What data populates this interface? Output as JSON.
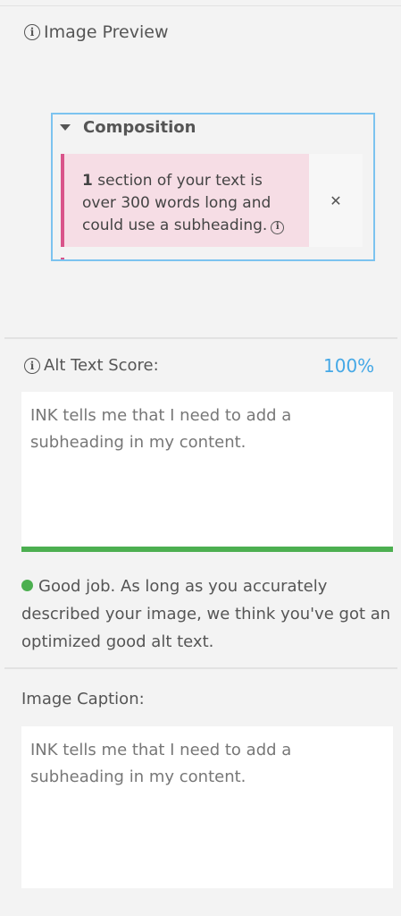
{
  "preview": {
    "label": "Image Preview",
    "composition_label": "Composition",
    "notice_count": "1",
    "notice_text": "section of your text is over 300 words long and could use a subheading."
  },
  "alt_text": {
    "label": "Alt Text Score:",
    "score": "100%",
    "value": "INK tells me that I need to add a subheading in my content.",
    "progress": 1.0,
    "feedback": "Good job. As long as you accurately described your image, we think you've got an optimized good alt text."
  },
  "caption": {
    "label": "Image Caption:",
    "value": "INK tells me that I need to add a subheading in my content."
  },
  "colors": {
    "accent_blue": "#45a8e6",
    "success_green": "#4caf50",
    "notice_pink": "#d9548a"
  }
}
